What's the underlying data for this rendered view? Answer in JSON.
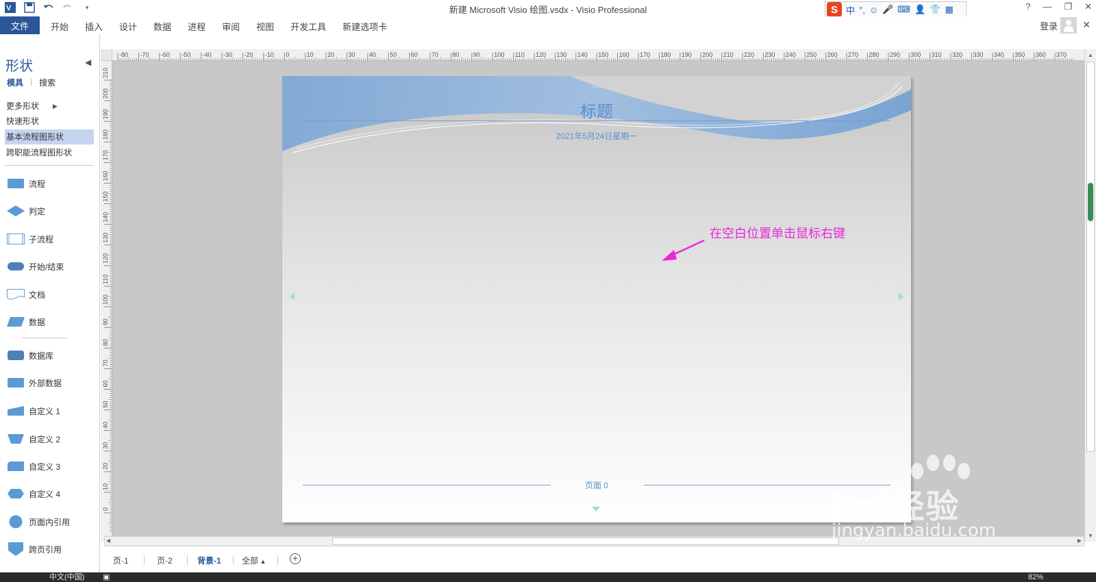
{
  "window": {
    "title": "新建 Microsoft Visio 绘图.vsdx - Visio Professional",
    "controls": [
      "?",
      "—",
      "❐",
      "✕"
    ]
  },
  "ime": {
    "items": [
      "中",
      "°,",
      "☺",
      "🎤",
      "⌨",
      "👤",
      "👕",
      "▦"
    ]
  },
  "ribbon": {
    "file_label": "文件",
    "tabs": [
      "开始",
      "插入",
      "设计",
      "数据",
      "进程",
      "审阅",
      "视图",
      "开发工具",
      "新建选项卡"
    ],
    "signin_label": "登录"
  },
  "shapes_pane": {
    "title": "形状",
    "tab_stencils": "模具",
    "tab_search": "搜索",
    "stencils": [
      {
        "label": "更多形状",
        "has_submenu": true
      },
      {
        "label": "快速形状"
      },
      {
        "label": "基本流程图形状",
        "active": true
      },
      {
        "label": "跨职能流程图形状"
      }
    ],
    "shapes": [
      {
        "label": "流程",
        "icon": "process-shape-icon"
      },
      {
        "label": "判定",
        "icon": "decision-shape-icon"
      },
      {
        "label": "子流程",
        "icon": "subprocess-shape-icon"
      },
      {
        "label": "开始/结束",
        "icon": "terminator-shape-icon"
      },
      {
        "label": "文档",
        "icon": "document-shape-icon"
      },
      {
        "label": "数据",
        "icon": "data-shape-icon"
      },
      {
        "label": "数据库",
        "icon": "database-shape-icon"
      },
      {
        "label": "外部数据",
        "icon": "external-data-shape-icon"
      },
      {
        "label": "自定义 1",
        "icon": "custom-1-shape-icon"
      },
      {
        "label": "自定义 2",
        "icon": "custom-2-shape-icon"
      },
      {
        "label": "自定义 3",
        "icon": "custom-3-shape-icon"
      },
      {
        "label": "自定义 4",
        "icon": "custom-4-shape-icon"
      },
      {
        "label": "页面内引用",
        "icon": "on-page-reference-shape-icon"
      },
      {
        "label": "跨页引用",
        "icon": "off-page-reference-shape-icon"
      }
    ]
  },
  "rulers": {
    "horizontal": [
      "-80",
      "-70",
      "-60",
      "-50",
      "-40",
      "-30",
      "-20",
      "-10",
      "0",
      "10",
      "20",
      "30",
      "40",
      "50",
      "60",
      "70",
      "80",
      "90",
      "100",
      "110",
      "120",
      "130",
      "140",
      "150",
      "160",
      "170",
      "180",
      "190",
      "200",
      "210",
      "220",
      "230",
      "240",
      "250",
      "260",
      "270",
      "280",
      "290",
      "300",
      "310",
      "320",
      "330",
      "340",
      "350",
      "360",
      "370"
    ],
    "vertical": [
      "210",
      "200",
      "190",
      "180",
      "170",
      "160",
      "150",
      "140",
      "130",
      "120",
      "110",
      "100",
      "90",
      "80",
      "70",
      "60",
      "50",
      "40",
      "30",
      "20",
      "10",
      "0"
    ]
  },
  "page": {
    "title": "标题",
    "date": "2021年5月24日星期一",
    "footer": "页面 0"
  },
  "annotation": {
    "text": "在空白位置单击鼠标右键",
    "color": "#ea27d8"
  },
  "page_tabs": {
    "tabs": [
      "页-1",
      "页-2",
      "背景-1"
    ],
    "active_index": 2,
    "all_label": "全部"
  },
  "statusbar": {
    "language": "中文(中国)",
    "zoom": "82%"
  },
  "watermark": {
    "brand": "Bai经验",
    "url": "jingyan.baidu.com"
  },
  "colors": {
    "accent": "#2b579a",
    "page_text": "#5b8fd0",
    "annotation": "#ea27d8"
  }
}
